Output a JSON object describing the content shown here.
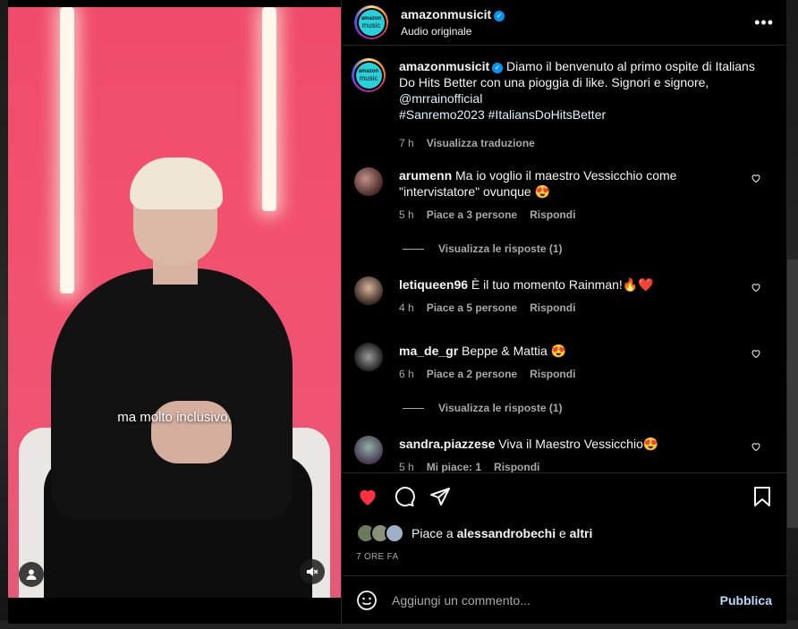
{
  "post": {
    "author": "amazonmusicit",
    "audio_label": "Audio originale",
    "avatar_text_top": "amazon",
    "avatar_text_bottom": "music",
    "caption_text": "Diamo il benvenuto al primo ospite di Italians Do Hits Better con una pioggia di like. Signori e signore,",
    "caption_mention": "@mrrainofficial",
    "caption_tag1": "#Sanremo2023",
    "caption_tag2": "#ItaliansDoHitsBetter",
    "caption_time": "7 h",
    "caption_translate": "Visualizza traduzione"
  },
  "video": {
    "subtitle": "ma molto inclusivo."
  },
  "comments": [
    {
      "user": "arumenn",
      "text": "Ma io voglio il maestro Vessicchio come \"intervistatore\" ovunque 😍",
      "time": "5 h",
      "likes": "Piace a 3 persone",
      "reply": "Rispondi",
      "view_replies": "Visualizza le risposte (1)"
    },
    {
      "user": "letiqueen96",
      "text": "È il tuo momento Rainman!🔥❤️",
      "time": "4 h",
      "likes": "Piace a 5 persone",
      "reply": "Rispondi"
    },
    {
      "user": "ma_de_gr",
      "text": "Beppe & Mattia 😍",
      "time": "6 h",
      "likes": "Piace a 2 persone",
      "reply": "Rispondi",
      "view_replies": "Visualizza le risposte (1)"
    },
    {
      "user": "sandra.piazzese",
      "text": "Viva il Maestro Vessicchio😍",
      "time": "5 h",
      "likes": "Mi piace: 1",
      "reply": "Rispondi"
    }
  ],
  "likes_summary": {
    "prefix": "Piace a",
    "user": "alessandrobechi",
    "middle": "e",
    "others": "altri"
  },
  "timestamp": "7 ORE FA",
  "add_comment": {
    "placeholder": "Aggiungi un commento...",
    "publish": "Pubblica"
  },
  "colors": {
    "accent": "#0095f6",
    "like_red": "#ff3040",
    "publish": "#b3dbff"
  }
}
